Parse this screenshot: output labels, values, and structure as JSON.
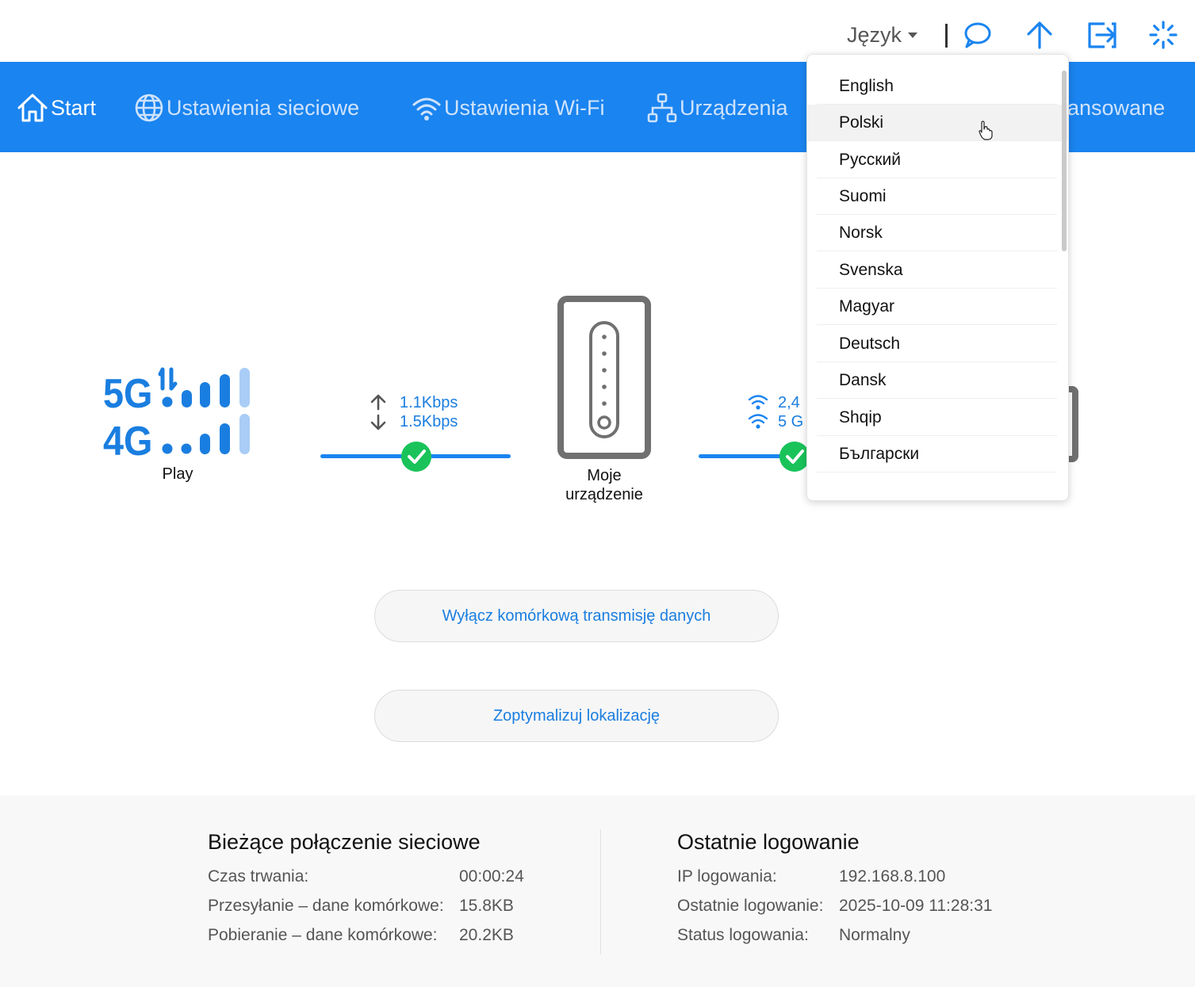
{
  "header": {
    "language_label": "Język",
    "icons": [
      "message-icon",
      "update-arrow-icon",
      "logout-icon",
      "loading-icon"
    ]
  },
  "nav": {
    "items": [
      {
        "label": "Start",
        "icon": "home-icon",
        "active": true
      },
      {
        "label": "Ustawienia sieciowe",
        "icon": "globe-icon"
      },
      {
        "label": "Ustawienia Wi-Fi",
        "icon": "wifi-icon"
      },
      {
        "label": "Urządzenia",
        "icon": "devices-icon"
      },
      {
        "label": "ansowane"
      }
    ]
  },
  "diagram": {
    "operator": "Play",
    "upload_speed": "1.1Kbps",
    "download_speed": "1.5Kbps",
    "device_label_line1": "Moje",
    "device_label_line2": "urządzenie",
    "wifi_24": "2,4",
    "wifi_5": "5 G"
  },
  "buttons": {
    "disable_data": "Wyłącz komórkową transmisję danych",
    "optimize_location": "Zoptymalizuj lokalizację"
  },
  "current_connection": {
    "title": "Bieżące połączenie sieciowe",
    "rows": [
      {
        "label": "Czas trwania:",
        "value": "00:00:24"
      },
      {
        "label": "Przesyłanie – dane komórkowe:",
        "value": "15.8KB"
      },
      {
        "label": "Pobieranie – dane komórkowe:",
        "value": "20.2KB"
      }
    ]
  },
  "last_login": {
    "title": "Ostatnie logowanie",
    "rows": [
      {
        "label": "IP logowania:",
        "value": "192.168.8.100"
      },
      {
        "label": "Ostatnie logowanie:",
        "value": "2025-10-09 11:28:31"
      },
      {
        "label": "Status logowania:",
        "value": "Normalny"
      }
    ]
  },
  "language_menu": {
    "items": [
      "English",
      "Polski",
      "Русский",
      "Suomi",
      "Norsk",
      "Svenska",
      "Magyar",
      "Deutsch",
      "Dansk",
      "Shqip",
      "Български"
    ],
    "hovered": "Polski"
  },
  "colors": {
    "accent": "#1a84f0",
    "nav_text": "#cfe3fb",
    "link": "#1a7ee0",
    "success": "#19c35a",
    "signal_light": "#a9cdf6"
  }
}
